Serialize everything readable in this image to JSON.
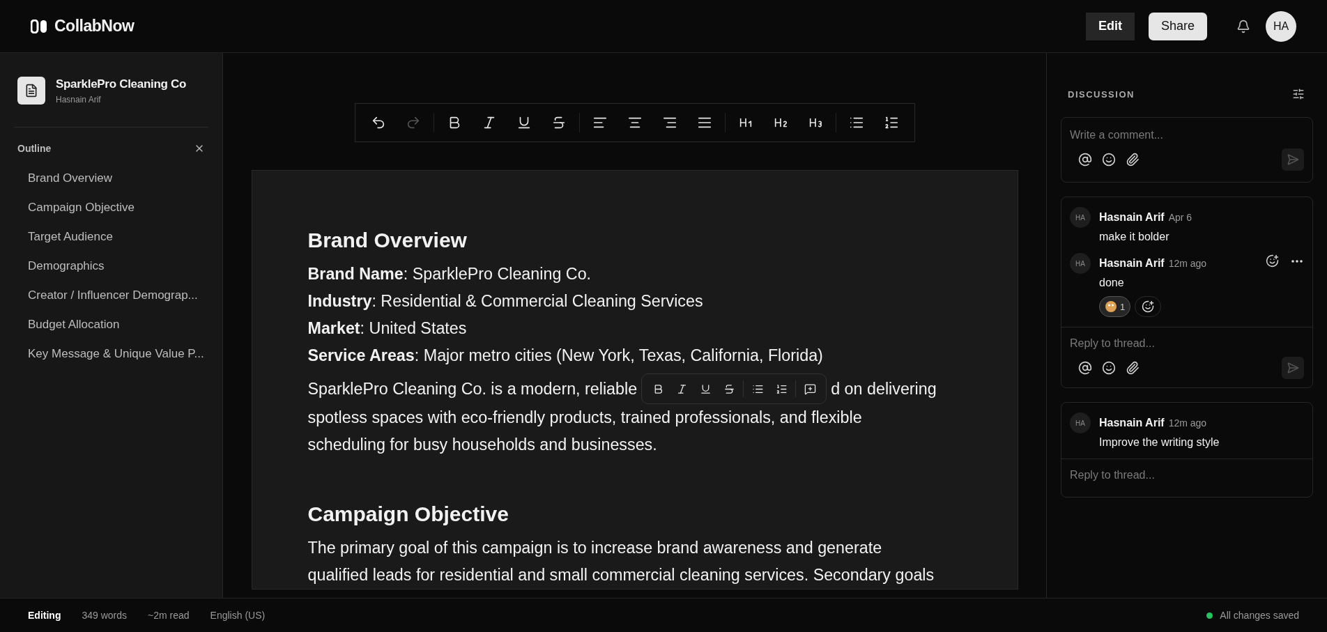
{
  "app": {
    "name": "CollabNow"
  },
  "header": {
    "buttons": [
      {
        "label": "Edit",
        "kind": "mode"
      },
      {
        "label": "Share",
        "kind": "share"
      }
    ],
    "avatar": "HA"
  },
  "document": {
    "title": "SparklePro Cleaning Co",
    "owner": "Hasnain Arif"
  },
  "outline": {
    "title": "Outline",
    "items": [
      "Brand Overview",
      "Campaign Objective",
      "Target Audience",
      "Demographics",
      "Creator / Influencer Demograp...",
      "Budget Allocation",
      "Key Message & Unique Value P..."
    ]
  },
  "toolbar": {
    "groups": [
      [
        {
          "kind": "undo",
          "disabled": false
        },
        {
          "kind": "redo",
          "disabled": true
        }
      ],
      [
        {
          "kind": "bold",
          "disabled": false
        },
        {
          "kind": "italic",
          "disabled": false
        },
        {
          "kind": "underline",
          "disabled": false
        },
        {
          "kind": "strike",
          "disabled": false
        }
      ],
      [
        {
          "kind": "align-left",
          "disabled": false
        },
        {
          "kind": "align-center",
          "disabled": false
        },
        {
          "kind": "align-right",
          "disabled": false
        },
        {
          "kind": "justify",
          "disabled": false
        }
      ],
      [
        {
          "kind": "h1",
          "disabled": false
        },
        {
          "kind": "h2",
          "disabled": false
        },
        {
          "kind": "h3",
          "disabled": false
        }
      ],
      [
        {
          "kind": "bullets",
          "disabled": false
        },
        {
          "kind": "numbers",
          "disabled": false
        }
      ]
    ]
  },
  "selection_toolbar": {
    "groups": [
      [
        {
          "kind": "bold"
        },
        {
          "kind": "italic"
        },
        {
          "kind": "underline"
        },
        {
          "kind": "strike"
        }
      ],
      [
        {
          "kind": "bullets"
        },
        {
          "kind": "numbers"
        }
      ],
      [
        {
          "kind": "comment"
        }
      ]
    ]
  },
  "editor": {
    "sections": [
      {
        "heading": "Brand Overview",
        "facts": [
          "**Brand Name**: SparklePro Cleaning Co.",
          "**Industry**: Residential & Commercial Cleaning Services",
          "**Market**: United States",
          "**Service Areas**: Major metro cities (New York, Texas, California, Florida)"
        ],
        "paragraph": {
          "before": "SparklePro Cleaning Co. is a modern, reliable",
          "after": "d on delivering",
          "rest": "spotless spaces with eco-friendly products, trained professionals, and flexible scheduling for busy households and businesses."
        }
      },
      {
        "heading": "Campaign Objective",
        "paragraph": {
          "before": "The primary goal of this campaign is to increase brand awareness and generate qualified leads for residential and small commercial cleaning services. Secondary goals"
        }
      }
    ]
  },
  "discussion": {
    "title": "DISCUSSION",
    "composer": {
      "placeholder": "Write a comment..."
    },
    "threads": [
      {
        "expanded": true,
        "reply_placeholder": "Reply to thread...",
        "comments": [
          {
            "avatar": "HA",
            "author": "Hasnain Arif",
            "time": "Apr 6",
            "text": "make it bolder",
            "actions": false
          },
          {
            "avatar": "HA",
            "author": "Hasnain Arif",
            "time": "12m ago",
            "text": "done",
            "actions": true,
            "reactions": [
              {
                "count": "1"
              }
            ]
          }
        ]
      },
      {
        "expanded": false,
        "reply_placeholder": "Reply to thread...",
        "comments": [
          {
            "avatar": "HA",
            "author": "Hasnain Arif",
            "time": "12m ago",
            "text": "Improve the writing style",
            "actions": false
          }
        ]
      }
    ]
  },
  "status_bar": {
    "mode": "Editing",
    "words": "349 words",
    "read_time": "~2m read",
    "language": "English (US)",
    "save_status": "All changes saved"
  }
}
